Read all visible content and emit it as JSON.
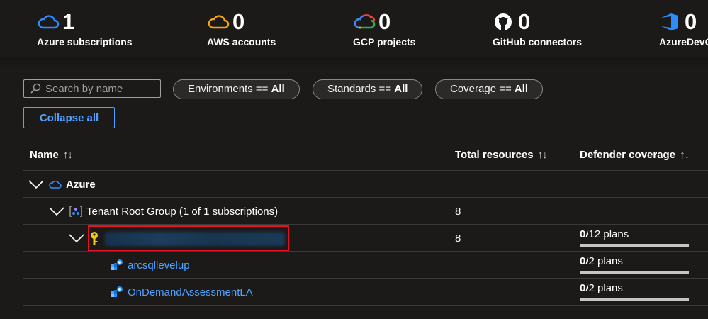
{
  "stats": [
    {
      "count": "1",
      "label": "Azure subscriptions",
      "icon": "azure-cloud-icon",
      "color": "#2d8cff"
    },
    {
      "count": "0",
      "label": "AWS accounts",
      "icon": "aws-cloud-icon",
      "color": "#f7a30b"
    },
    {
      "count": "0",
      "label": "GCP projects",
      "icon": "gcp-cloud-icon",
      "color": "#34a853"
    },
    {
      "count": "0",
      "label": "GitHub connectors",
      "icon": "github-icon",
      "color": "#ffffff"
    },
    {
      "count": "0",
      "label": "AzureDevO",
      "icon": "azure-devops-icon",
      "color": "#2d8cff"
    }
  ],
  "filters": {
    "search_placeholder": "Search by name",
    "pills": [
      {
        "name": "Environments",
        "op": " == ",
        "value": "All"
      },
      {
        "name": "Standards",
        "op": " == ",
        "value": "All"
      },
      {
        "name": "Coverage",
        "op": " == ",
        "value": "All"
      }
    ],
    "collapse_label": "Collapse all"
  },
  "table": {
    "headers": {
      "name": "Name",
      "total": "Total resources",
      "coverage": "Defender coverage",
      "sort_glyph": "↑↓"
    },
    "rows": [
      {
        "name": "Azure",
        "total": "",
        "coverage_num": "",
        "coverage_rest": ""
      },
      {
        "name": "Tenant Root Group (1 of 1 subscriptions)",
        "total": "8",
        "coverage_num": "",
        "coverage_rest": ""
      },
      {
        "name": "",
        "total": "8",
        "coverage_num": "0",
        "coverage_rest": "/12 plans",
        "coverage_fraction": 0
      },
      {
        "name": "arcsqllevelup",
        "total": "",
        "coverage_num": "0",
        "coverage_rest": "/2 plans",
        "coverage_fraction": 0
      },
      {
        "name": "OnDemandAssessmentLA",
        "total": "",
        "coverage_num": "0",
        "coverage_rest": "/2 plans",
        "coverage_fraction": 0
      }
    ]
  },
  "colors": {
    "accent": "#4fa3ff",
    "highlight": "#e81123",
    "key": "#f2c811"
  }
}
